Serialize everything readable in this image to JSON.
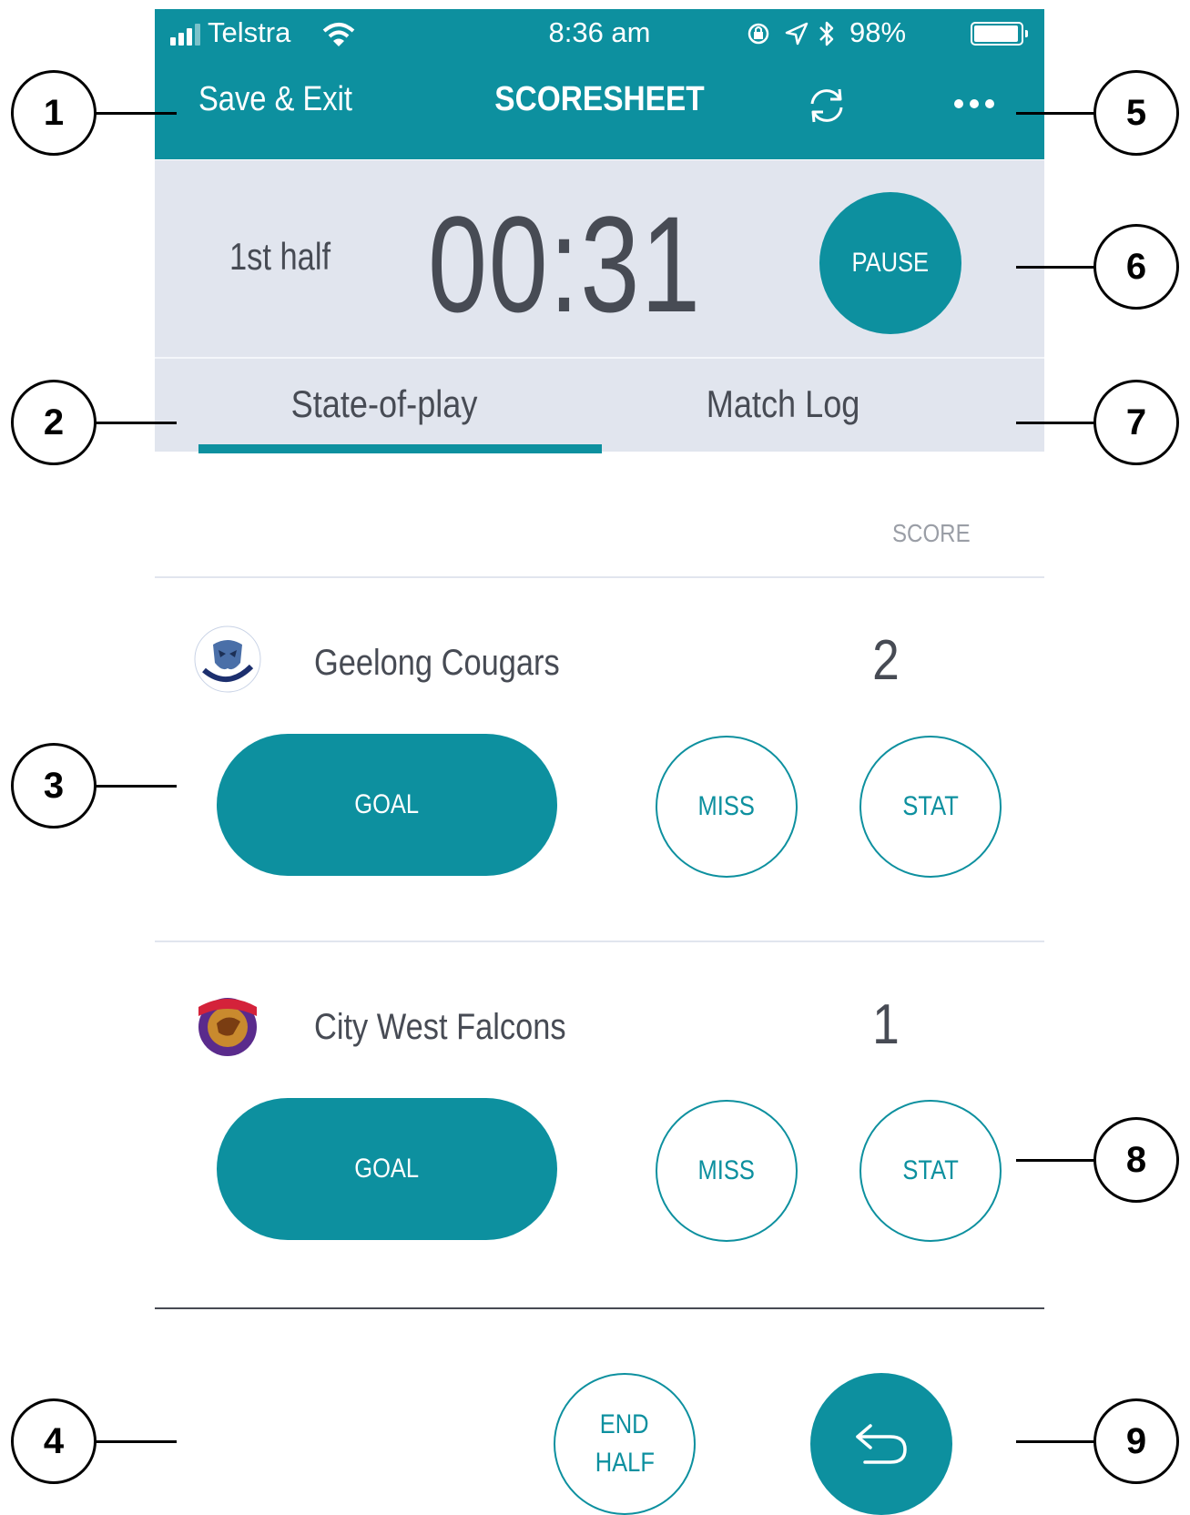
{
  "status_bar": {
    "carrier": "Telstra",
    "time": "8:36 am",
    "battery": "98%"
  },
  "nav": {
    "left_label": "Save & Exit",
    "title": "SCORESHEET",
    "refresh_icon": "refresh-icon",
    "more_icon": "more-dots-icon"
  },
  "timer": {
    "period": "1st half",
    "clock": "00:31",
    "pause_label": "PAUSE"
  },
  "tabs": [
    {
      "label": "State-of-play",
      "active": true
    },
    {
      "label": "Match Log",
      "active": false
    }
  ],
  "score_header": "SCORE",
  "teams": [
    {
      "name": "Geelong Cougars",
      "score": "2",
      "logo_icon": "cougars-logo",
      "goal_label": "GOAL",
      "miss_label": "MISS",
      "stat_label": "STAT"
    },
    {
      "name": "City West Falcons",
      "score": "1",
      "logo_icon": "falcons-logo",
      "goal_label": "GOAL",
      "miss_label": "MISS",
      "stat_label": "STAT"
    }
  ],
  "footer": {
    "end_half_line1": "END",
    "end_half_line2": "HALF",
    "undo_icon": "undo-icon"
  },
  "callouts": [
    "1",
    "2",
    "3",
    "4",
    "5",
    "6",
    "7",
    "8",
    "9"
  ],
  "colors": {
    "accent": "#0d909f",
    "panel": "#e1e5ee",
    "text": "#474b54",
    "muted": "#9a9ea6"
  }
}
